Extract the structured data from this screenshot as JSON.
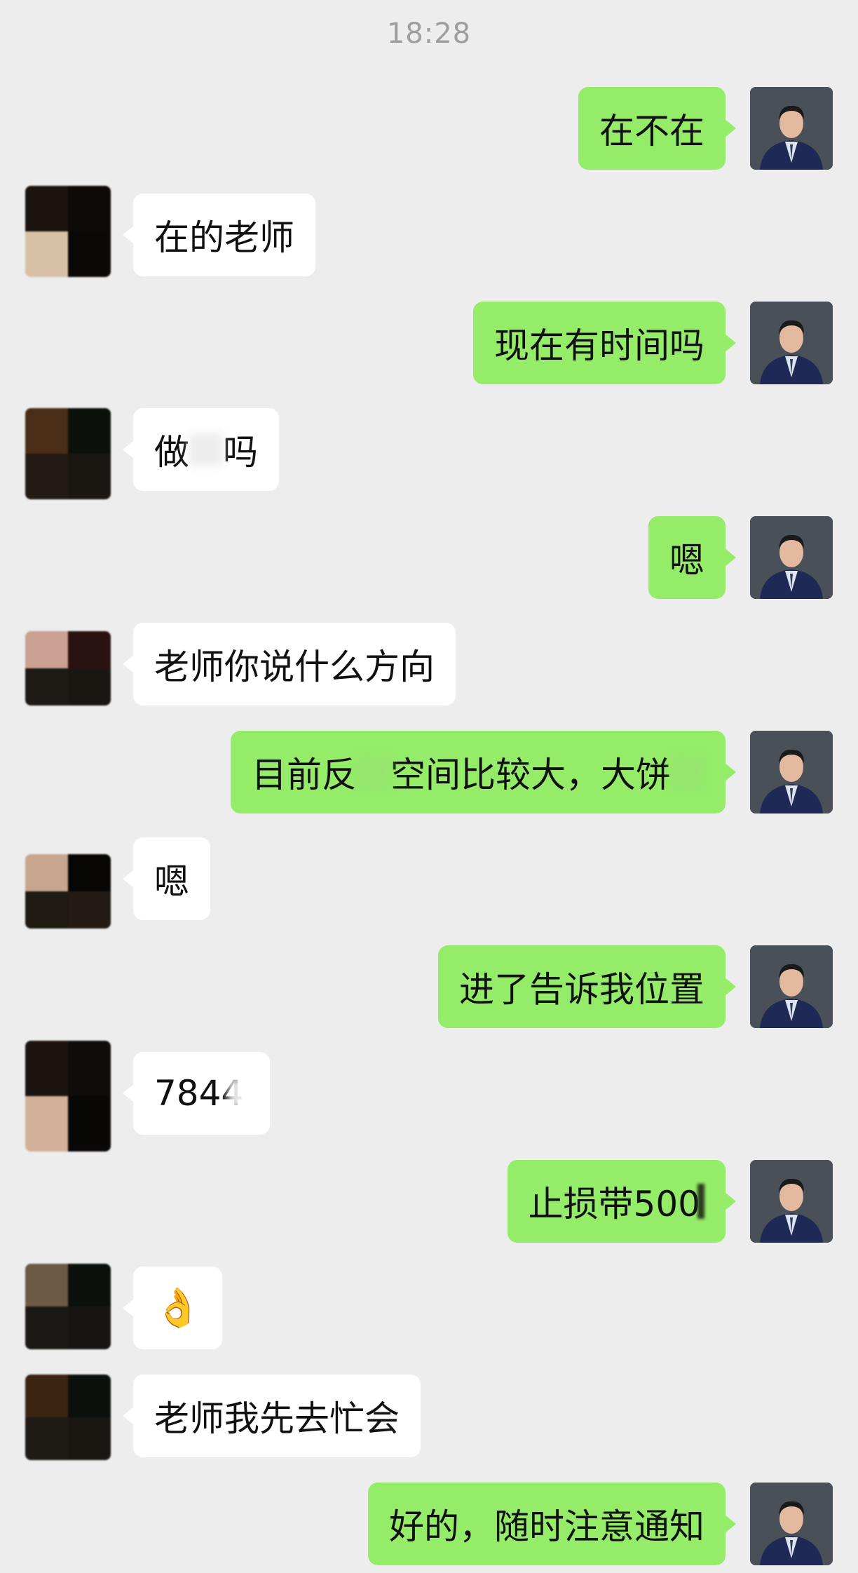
{
  "timestamp": "18:28",
  "messages": [
    {
      "side": "out",
      "text": "在不在"
    },
    {
      "side": "in",
      "text": "在的老师"
    },
    {
      "side": "out",
      "text": "现在有时间吗"
    },
    {
      "side": "in",
      "text_a": "做",
      "text_b": "吗"
    },
    {
      "side": "out",
      "text": "嗯"
    },
    {
      "side": "in",
      "text": "老师你说什么方向"
    },
    {
      "side": "out",
      "text_a": "目前反",
      "text_b": "空间比较大，大饼",
      "text_c": ""
    },
    {
      "side": "in",
      "text": "嗯"
    },
    {
      "side": "out",
      "text": "进了告诉我位置"
    },
    {
      "side": "in",
      "text": "7844"
    },
    {
      "side": "out",
      "text": "止损带500"
    },
    {
      "side": "in",
      "text": "👌"
    },
    {
      "side": "in",
      "text": "老师我先去忙会"
    },
    {
      "side": "out",
      "text": "好的，随时注意通知"
    }
  ],
  "colors": {
    "outgoing_bubble": "#95ec69",
    "incoming_bubble": "#ffffff",
    "background": "#ededed"
  }
}
